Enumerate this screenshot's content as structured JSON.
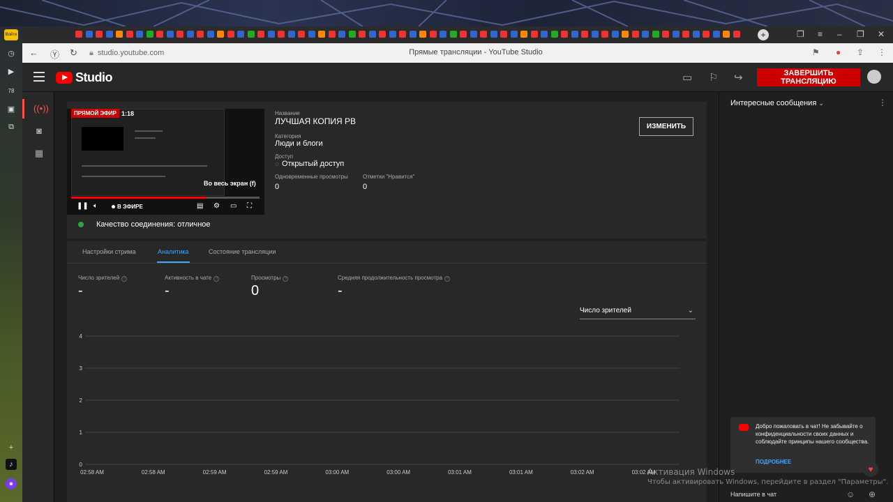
{
  "browser": {
    "url": "studio.youtube.com",
    "page_title": "Прямые трансляции - YouTube Studio",
    "login_label": "Войти"
  },
  "header": {
    "logo_text": "Studio",
    "end_stream_label": "ЗАВЕРШИТЬ ТРАНСЛЯЦИЮ"
  },
  "player": {
    "live_badge": "ПРЯМОЙ ЭФИР",
    "time": "1:18",
    "fullscreen_tooltip": "Во весь экран (f)",
    "live_label": "В ЭФИРЕ",
    "progress": 0.72
  },
  "connection": {
    "text": "Качество соединения: отличное",
    "color": "#2ba640"
  },
  "stream_info": {
    "title_label": "Название",
    "title": "ЛУЧШАЯ КОПИЯ РВ",
    "category_label": "Категория",
    "category": "Люди и блоги",
    "access_label": "Доступ",
    "access": "Открытый доступ",
    "concurrent_label": "Одновременные просмотры",
    "concurrent_value": "0",
    "likes_label": "Отметки \"Нравится\"",
    "likes_value": "0",
    "edit_label": "ИЗМЕНИТЬ"
  },
  "tabs": [
    {
      "label": "Настройки стрима"
    },
    {
      "label": "Аналитика"
    },
    {
      "label": "Состояние трансляции"
    }
  ],
  "metrics": [
    {
      "label": "Число зрителей",
      "value": "-"
    },
    {
      "label": "Активность в чате",
      "value": "-"
    },
    {
      "label": "Просмотры",
      "value": "0"
    },
    {
      "label": "Средняя продолжительность просмотра",
      "value": "-"
    }
  ],
  "metric_selector": "Число зрителей",
  "chart_data": {
    "type": "line",
    "x": [
      "02:58 AM",
      "02:58 AM",
      "02:59 AM",
      "02:59 AM",
      "03:00 AM",
      "03:00 AM",
      "03:01 AM",
      "03:01 AM",
      "03:02 AM",
      "03:02 AM"
    ],
    "series": [],
    "y_ticks": [
      "0",
      "1",
      "2",
      "3",
      "4"
    ],
    "ylim": [
      0,
      4
    ],
    "grid": true
  },
  "chat": {
    "title": "Интересные сообщения",
    "welcome_text": "Добро пожаловать в чат! Не забывайте о конфиденциальности своих данных и соблюдайте принципы нашего сообщества.",
    "more_label": "ПОДРОБНЕЕ",
    "input_placeholder": "Напишите в чат"
  },
  "windows_watermark": {
    "line1": "Активация Windows",
    "line2": "Чтобы активировать Windows, перейдите в раздел \"Параметры\"."
  }
}
